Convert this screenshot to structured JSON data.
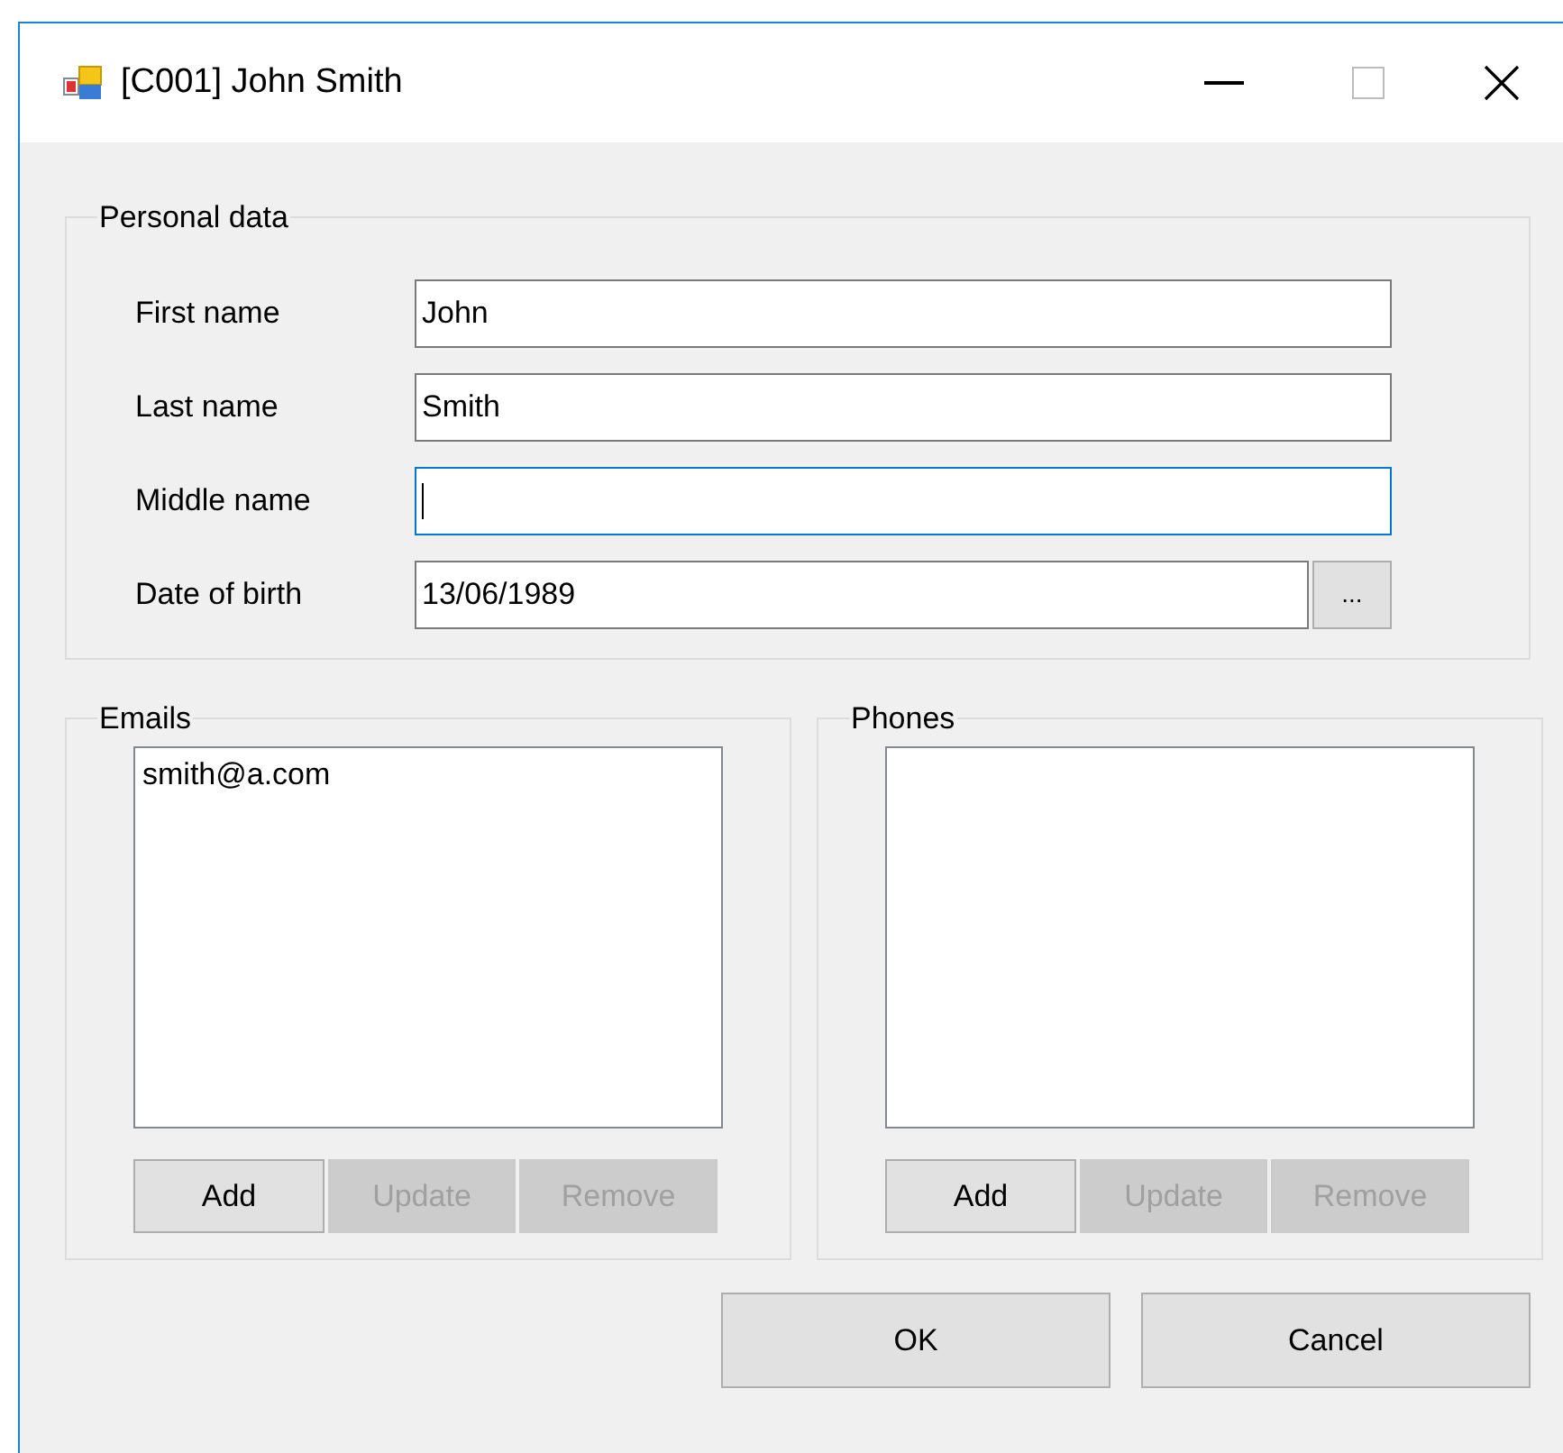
{
  "window": {
    "title": "[C001] John Smith"
  },
  "personal_data": {
    "title": "Personal data",
    "fields": [
      {
        "kind": "text",
        "label": "First name",
        "value": "John",
        "focused": false
      },
      {
        "kind": "text",
        "label": "Last name",
        "value": "Smith",
        "focused": false
      },
      {
        "kind": "text",
        "label": "Middle name",
        "focused": true
      },
      {
        "kind": "date",
        "label": "Date of birth",
        "value": "13/06/1989",
        "focused": false,
        "picker_button": "..."
      }
    ]
  },
  "emails": {
    "title": "Emails",
    "items": [
      "smith@a.com"
    ],
    "buttons": [
      {
        "label": "Add",
        "disabled": false
      },
      {
        "label": "Update",
        "disabled": true
      },
      {
        "label": "Remove",
        "disabled": true
      }
    ]
  },
  "phones": {
    "title": "Phones",
    "buttons": [
      {
        "label": "Add",
        "disabled": false
      },
      {
        "label": "Update",
        "disabled": true
      },
      {
        "label": "Remove",
        "disabled": true
      }
    ]
  },
  "buttons": [
    {
      "label": "OK"
    },
    {
      "label": "Cancel"
    }
  ]
}
